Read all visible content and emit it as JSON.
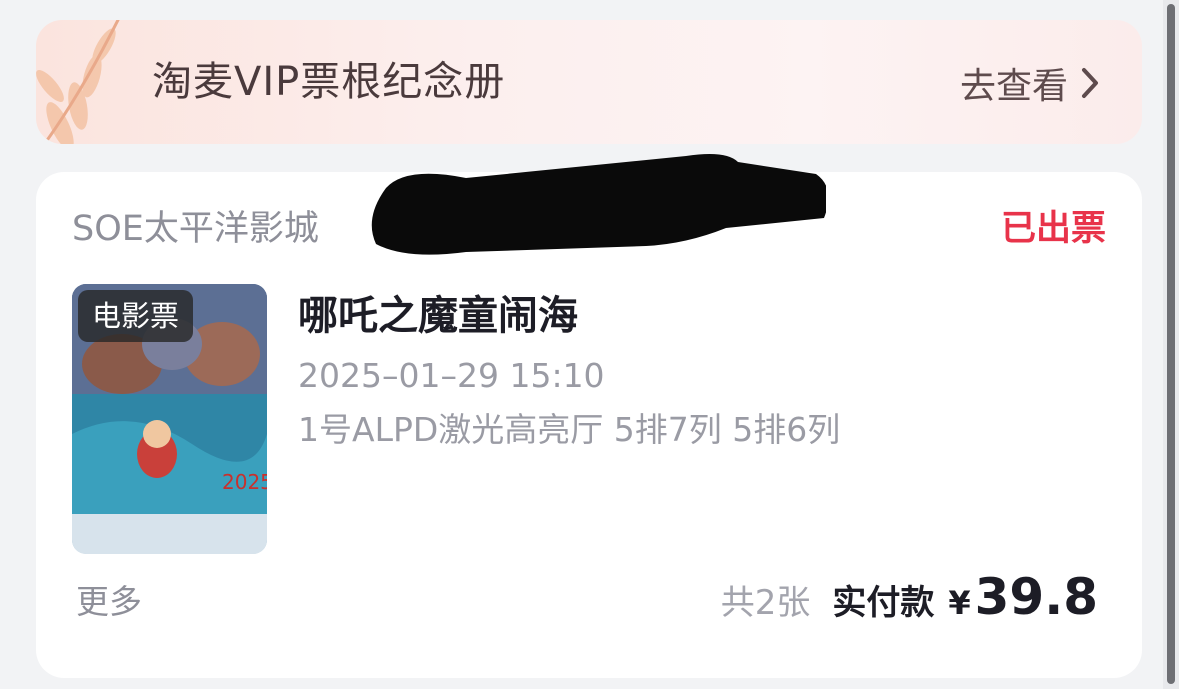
{
  "vip_banner": {
    "title": "淘麦VIP票根纪念册",
    "link_label": "去查看",
    "icon": "chevron-right-icon"
  },
  "order": {
    "cinema": "SOE太平洋影城",
    "status": "已出票",
    "poster_tag": "电影票",
    "movie_title": "哪吒之魔童闹海",
    "showtime": "2025–01–29 15:10",
    "hall_seats": "1号ALPD激光高亮厅 5排7列 5排6列",
    "more_label": "更多",
    "quantity": "共2张",
    "paid_label": "实付款",
    "currency": "¥",
    "amount": "39.8"
  },
  "colors": {
    "status": "#e8334a",
    "banner_bg": "#fbe4de",
    "text_primary": "#1d1d26",
    "text_secondary": "#9a9ba4"
  }
}
